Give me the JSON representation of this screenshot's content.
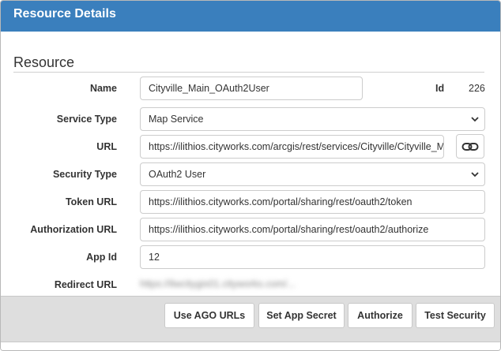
{
  "dialog": {
    "title": "Resource Details"
  },
  "section": {
    "title": "Resource"
  },
  "fields": {
    "name": {
      "label": "Name",
      "value": "Cityville_Main_OAuth2User"
    },
    "id": {
      "label": "Id",
      "value": "226"
    },
    "service_type": {
      "label": "Service Type",
      "value": "Map Service"
    },
    "url": {
      "label": "URL",
      "value": "https://ilithios.cityworks.com/arcgis/rest/services/Cityville/Cityville_Ma"
    },
    "security_type": {
      "label": "Security Type",
      "value": "OAuth2 User"
    },
    "token_url": {
      "label": "Token URL",
      "value": "https://ilithios.cityworks.com/portal/sharing/rest/oauth2/token"
    },
    "authorization_url": {
      "label": "Authorization URL",
      "value": "https://ilithios.cityworks.com/portal/sharing/rest/oauth2/authorize"
    },
    "app_id": {
      "label": "App Id",
      "value": "12"
    },
    "redirect_url": {
      "label": "Redirect URL",
      "value": "https://ilwcitygis01.cityworks.com/..."
    }
  },
  "icons": {
    "url_link": "link-icon",
    "select_chevron": "chevron-down-icon"
  },
  "buttons": {
    "use_ago_urls": "Use AGO URLs",
    "set_app_secret": "Set App Secret",
    "authorize": "Authorize",
    "test_security": "Test Security"
  },
  "colors": {
    "titlebar": "#3a7fbd",
    "footer": "#dedede"
  }
}
